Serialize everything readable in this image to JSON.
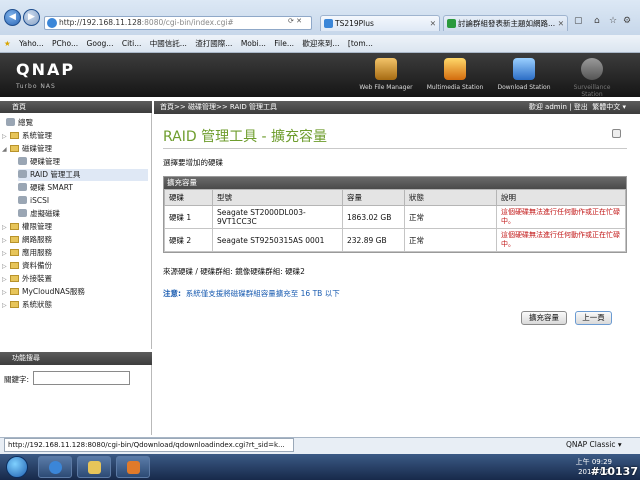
{
  "browser": {
    "url_main": "http://192.168.11.128",
    "url_rest": ":8080/cgi-bin/index.cgi#",
    "tabs": [
      "TS219Plus",
      "討論群組發表新主題如網路..."
    ],
    "favorites": [
      "Yaho...",
      "PCho...",
      "Goog...",
      "Citi...",
      "中國信託...",
      "渣打國際...",
      "Mobi...",
      "File...",
      "歡迎來到...",
      "[tom..."
    ],
    "status_url": "http://192.168.11.128:8080/cgi-bin/Qdownload/qdownloadindex.cgi?rt_sid=k..."
  },
  "header": {
    "logo": "QNAP",
    "sublogo": "Turbo NAS",
    "apps": [
      "Web File Manager",
      "Multimedia Station",
      "Download Station",
      "Surveillance Station"
    ]
  },
  "nav": {
    "header": "首頁",
    "items": [
      "總覽",
      "系統管理",
      "磁碟管理",
      "硬碟管理",
      "RAID 管理工具",
      "硬碟 SMART",
      "iSCSI",
      "虛擬磁碟",
      "權限管理",
      "網路服務",
      "應用服務",
      "資料備份",
      "外接裝置",
      "MyCloudNAS服務",
      "系統狀態"
    ]
  },
  "search": {
    "header": "功能搜尋",
    "label": "關鍵字:"
  },
  "breadcrumb": {
    "path": "首頁>> 磁碟管理>> RAID 管理工具",
    "welcome": "歡迎 admin | 登出",
    "language": "繁體中文"
  },
  "page": {
    "title": "RAID 管理工具 - 擴充容量",
    "instruction": "選擇要增加的硬碟",
    "table_title": "擴充容量",
    "columns": [
      "硬碟",
      "型號",
      "容量",
      "狀態",
      "說明"
    ],
    "rows": [
      {
        "disk": "硬碟 1",
        "model": "Seagate ST2000DL003-9VT1CC3C",
        "capacity": "1863.02 GB",
        "status": "正常",
        "note": "這個硬碟無法進行任何動作或正在忙碌中。"
      },
      {
        "disk": "硬碟 2",
        "model": "Seagate ST9250315AS 0001",
        "capacity": "232.89 GB",
        "status": "正常",
        "note": "這個硬碟無法進行任何動作或正在忙碌中。"
      }
    ],
    "source": "來源硬碟 / 硬碟群組: 鏡像硬碟群組: 硬碟2",
    "note_label": "注意:",
    "note_text": "系統僅支援將磁碟群組容量擴充至 16 TB 以下",
    "expand_button": "擴充容量",
    "back_button": "上一頁"
  },
  "statusbar": {
    "theme": "QNAP Classic"
  },
  "taskbar": {
    "time": "上午 09:29",
    "date": "2011/7/2",
    "stamp": "#10137"
  }
}
